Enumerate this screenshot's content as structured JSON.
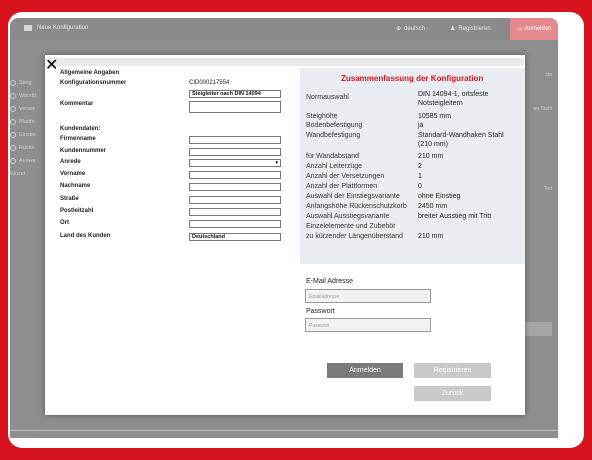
{
  "app": {
    "brand_label": "Neue Konfiguration",
    "lang_label": "deutsch",
    "register_label": "Registrieren",
    "login_label": "Anmelden"
  },
  "sidebar": {
    "items": [
      {
        "label": "Steig"
      },
      {
        "label": "Wandb"
      },
      {
        "label": "Verset"
      },
      {
        "label": "Plattfo"
      },
      {
        "label": "Einstie"
      },
      {
        "label": "Rücke"
      },
      {
        "label": "Auswa"
      },
      {
        "label": "Einzel"
      }
    ]
  },
  "background": {
    "right_text_1": "ste",
    "right_text_2": "en Stahl",
    "right_text_3": "Tritt"
  },
  "form": {
    "section_title": "Allgemeine Angaben",
    "config_number_label": "Konfigurationsnummer",
    "config_number_value": "CID000217554",
    "config_name_value": "Steigleiter nach DIN 14094",
    "comment_label": "Kommentar",
    "customer_section": "Kundendaten:",
    "fields": [
      {
        "label": "Firmenname",
        "value": ""
      },
      {
        "label": "Kundennummer",
        "value": ""
      },
      {
        "label": "Anrede",
        "value": ""
      },
      {
        "label": "Vorname",
        "value": ""
      },
      {
        "label": "Nachname",
        "value": ""
      },
      {
        "label": "Straße",
        "value": ""
      },
      {
        "label": "Postleitzahl",
        "value": ""
      },
      {
        "label": "Ort",
        "value": ""
      },
      {
        "label": "Land des Kunden",
        "value": "Deutschland"
      }
    ]
  },
  "summary": {
    "title": "Zusammenfassung der Konfiguration",
    "rows": [
      {
        "label": "Normauswahl",
        "value": "DIN 14094-1, ortsfeste"
      },
      {
        "label": "",
        "value": "Notsteigleitern"
      },
      {
        "label": "Steighöhe",
        "value": "10585 mm"
      },
      {
        "label": "Bodenbefestigung",
        "value": "ja"
      },
      {
        "label": "Wandbefestigung",
        "value": "Standard-Wandhaken Stahl"
      },
      {
        "label": "",
        "value": "(210 mm)"
      },
      {
        "label": "für Wandabstand",
        "value": "210 mm"
      },
      {
        "label": "Anzahl Leiterzüge",
        "value": "2"
      },
      {
        "label": "Anzahl der Versetzungen",
        "value": "1"
      },
      {
        "label": "Anzahl der Plattformen",
        "value": "0"
      },
      {
        "label": "Auswahl der Einstiegsvariante",
        "value": "ohne Einstieg"
      },
      {
        "label": "Anfangshöhe Rückenschutzkorb",
        "value": "2450 mm"
      },
      {
        "label": "Auswahl Ausstiegsvariante",
        "value": "breiter Ausstieg mit Tritt"
      },
      {
        "label": "Einzelelemente und Zubehör",
        "value": ""
      },
      {
        "label": "zu kürzender Längenüberstand",
        "value": "210 mm"
      }
    ]
  },
  "login": {
    "email_label": "E-Mail Adresse",
    "email_placeholder": "Emailadresse",
    "password_label": "Passwort",
    "password_placeholder": "Passwort",
    "login_button": "Anmelden",
    "register_button": "Registrieren",
    "back_button": "Zurück"
  },
  "colors": {
    "accent": "#d8141e",
    "login_button": "#7a7a7a",
    "secondary_button": "#c9c9c9",
    "summary_bg": "#e9ecf1"
  }
}
